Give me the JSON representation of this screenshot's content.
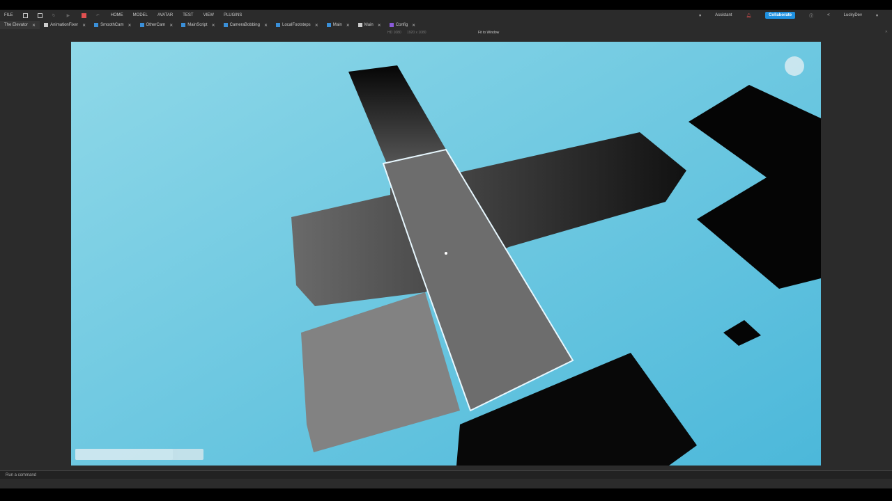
{
  "menu": {
    "file": "FILE",
    "items": [
      "HOME",
      "MODEL",
      "AVATAR",
      "TEST",
      "VIEW",
      "PLUGINS"
    ]
  },
  "right": {
    "assistant": "Assistant",
    "collaborate": "Collaborate",
    "user": "LuckyDev"
  },
  "tabs": [
    {
      "label": "The Elevator"
    },
    {
      "label": "AnimationFixer"
    },
    {
      "label": "SmoothCam"
    },
    {
      "label": "OtherCam"
    },
    {
      "label": "MainScript"
    },
    {
      "label": "CameraBobbing"
    },
    {
      "label": "LocalFootsteps"
    },
    {
      "label": "Main"
    },
    {
      "label": "Main"
    },
    {
      "label": "Config"
    }
  ],
  "viewbar": {
    "device": "HD 1080",
    "resolution": "1920 x 1080",
    "fit": "Fit to Window"
  },
  "command": {
    "placeholder": "Run a command"
  },
  "colors": {
    "sky": "#5cc6e0",
    "accent": "#1e90e0"
  }
}
